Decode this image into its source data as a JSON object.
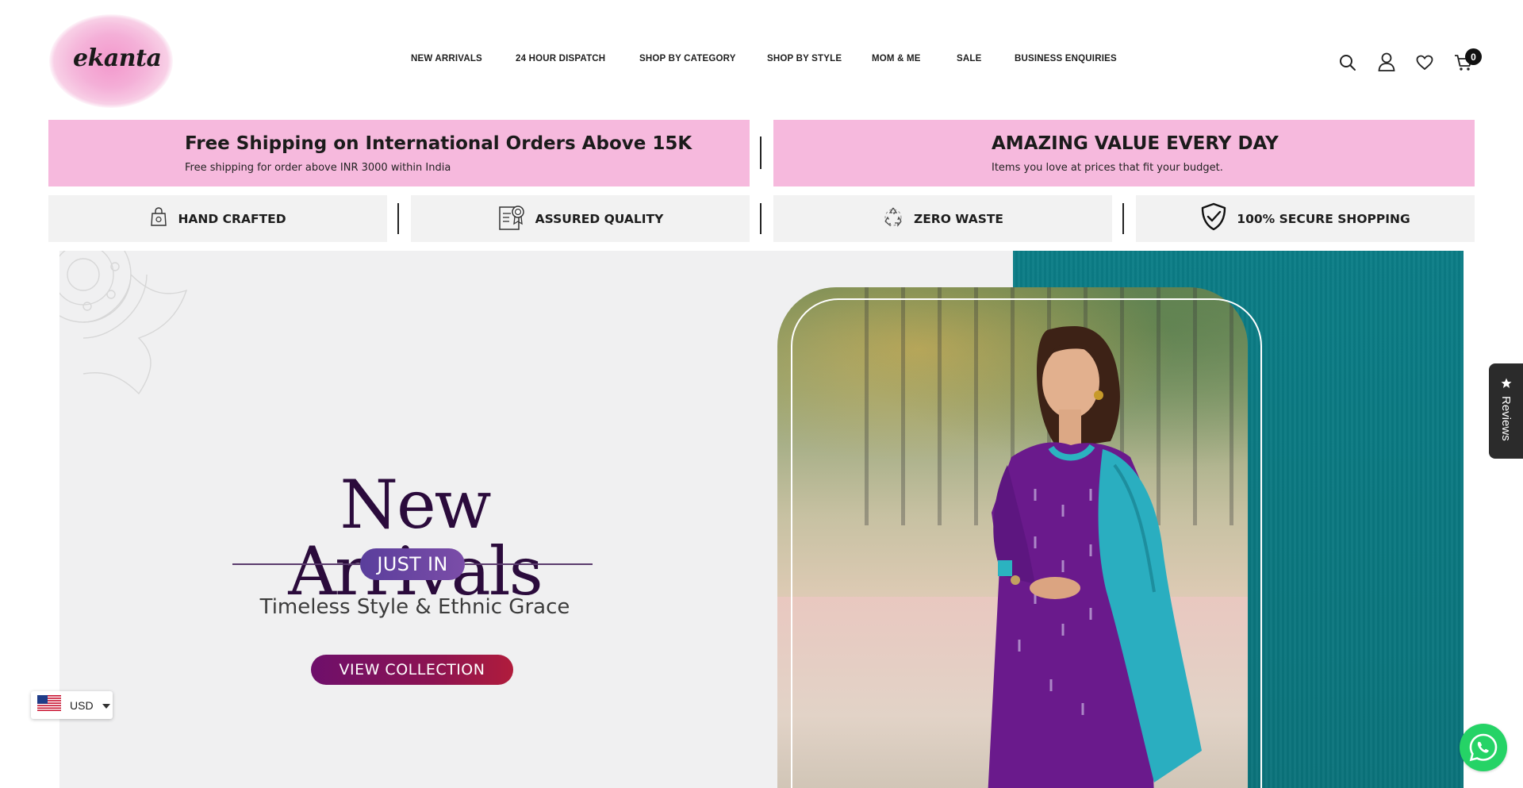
{
  "brand": {
    "logo_text": "ekanta"
  },
  "nav": {
    "items": [
      "NEW ARRIVALS",
      "24 HOUR DISPATCH",
      "SHOP BY CATEGORY",
      "SHOP BY STYLE",
      "MOM & ME",
      "SALE",
      "BUSINESS ENQUIRIES"
    ]
  },
  "header_icons": {
    "search": "search-icon",
    "account": "user-icon",
    "wishlist": "heart-icon",
    "cart": "cart-icon",
    "cart_count": "0"
  },
  "promos": [
    {
      "title": "Free Shipping on International Orders Above 15K",
      "subtitle": "Free shipping for order above INR 3000 within India"
    },
    {
      "title": "AMAZING VALUE EVERY DAY",
      "subtitle": "Items you love at prices that fit your budget."
    }
  ],
  "features": [
    {
      "label": "HAND CRAFTED",
      "icon": "shopping-bag-icon"
    },
    {
      "label": "ASSURED QUALITY",
      "icon": "certificate-icon"
    },
    {
      "label": "ZERO WASTE",
      "icon": "recycle-icon"
    },
    {
      "label": "100% SECURE SHOPPING",
      "icon": "shield-check-icon"
    }
  ],
  "hero": {
    "title": "New Arrivals",
    "pill": "JUST IN",
    "tagline": "Timeless Style & Ethnic Grace",
    "cta": "VIEW COLLECTION"
  },
  "widgets": {
    "currency": "USD",
    "reviews": "Reviews",
    "whatsapp": "whatsapp-icon"
  },
  "colors": {
    "promo_pink": "#f6b9dd",
    "hero_bg": "#f0f0f1",
    "teal": "#0b7d86",
    "title_purple": "#2b0b3c",
    "cta_gradient_start": "#6e0f6b",
    "cta_gradient_end": "#b01c3c"
  }
}
